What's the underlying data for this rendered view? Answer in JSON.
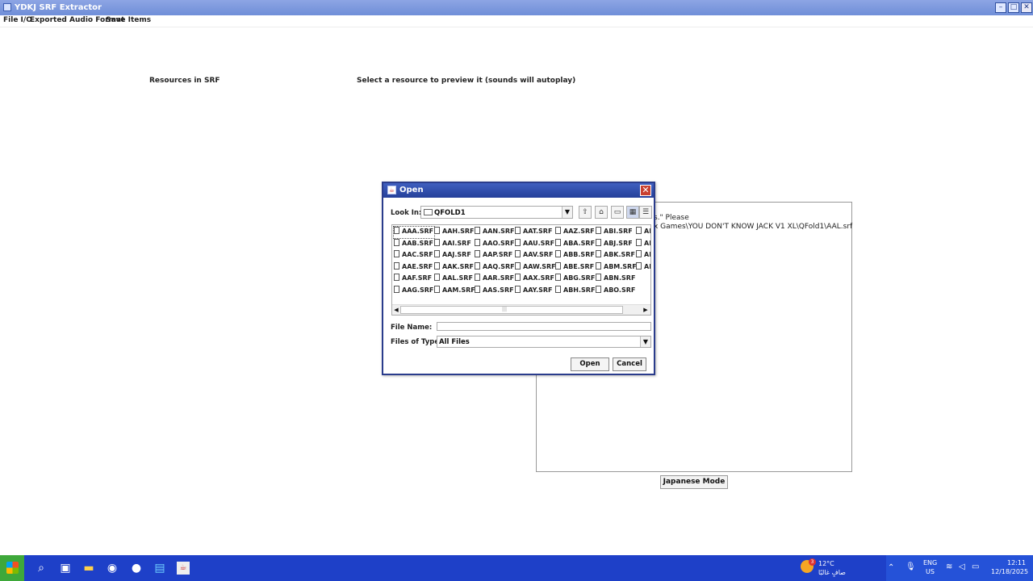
{
  "window": {
    "title": "YDKJ SRF Extractor"
  },
  "menubar": {
    "items": [
      "File I/O",
      "Exported Audio Format",
      "Save Items"
    ]
  },
  "main": {
    "resources_label": "Resources in SRF",
    "preview_label": "Select a resource to preview it  (sounds will autoplay)",
    "preview_text": [
      "s.\" Please",
      "x Games\\YOU DON'T KNOW JACK V1 XL\\QFold1\\AAL.srf"
    ],
    "japanese_mode_label": "Japanese Mode"
  },
  "dialog": {
    "title": "Open",
    "look_in_label": "Look In:",
    "look_in_value": "QFOLD1",
    "files": [
      [
        "AAA.SRF",
        "AAB.SRF",
        "AAC.SRF",
        "AAE.SRF",
        "AAF.SRF",
        "AAG.SRF"
      ],
      [
        "AAH.SRF",
        "AAI.SRF",
        "AAJ.SRF",
        "AAK.SRF",
        "AAL.SRF",
        "AAM.SRF"
      ],
      [
        "AAN.SRF",
        "AAO.SRF",
        "AAP.SRF",
        "AAQ.SRF",
        "AAR.SRF",
        "AAS.SRF"
      ],
      [
        "AAT.SRF",
        "AAU.SRF",
        "AAV.SRF",
        "AAW.SRF",
        "AAX.SRF",
        "AAY.SRF"
      ],
      [
        "AAZ.SRF",
        "ABA.SRF",
        "ABB.SRF",
        "ABE.SRF",
        "ABG.SRF",
        "ABH.SRF"
      ],
      [
        "ABI.SRF",
        "ABJ.SRF",
        "ABK.SRF",
        "ABM.SRF",
        "ABN.SRF",
        "ABO.SRF"
      ],
      [
        "AB",
        "AB",
        "AB",
        "AB"
      ]
    ],
    "selected_file": "AAA.SRF",
    "file_name_label": "File Name:",
    "file_name_value": "",
    "files_of_type_label": "Files of Type:",
    "files_of_type_value": "All Files",
    "open_button": "Open",
    "cancel_button": "Cancel"
  },
  "taskbar": {
    "weather_temp": "12°C",
    "weather_desc": "صافٍ غالبًا",
    "weather_badge": "3",
    "lang_top": "ENG",
    "lang_bottom": "US",
    "time": "12:11",
    "date": "12/18/2025"
  }
}
